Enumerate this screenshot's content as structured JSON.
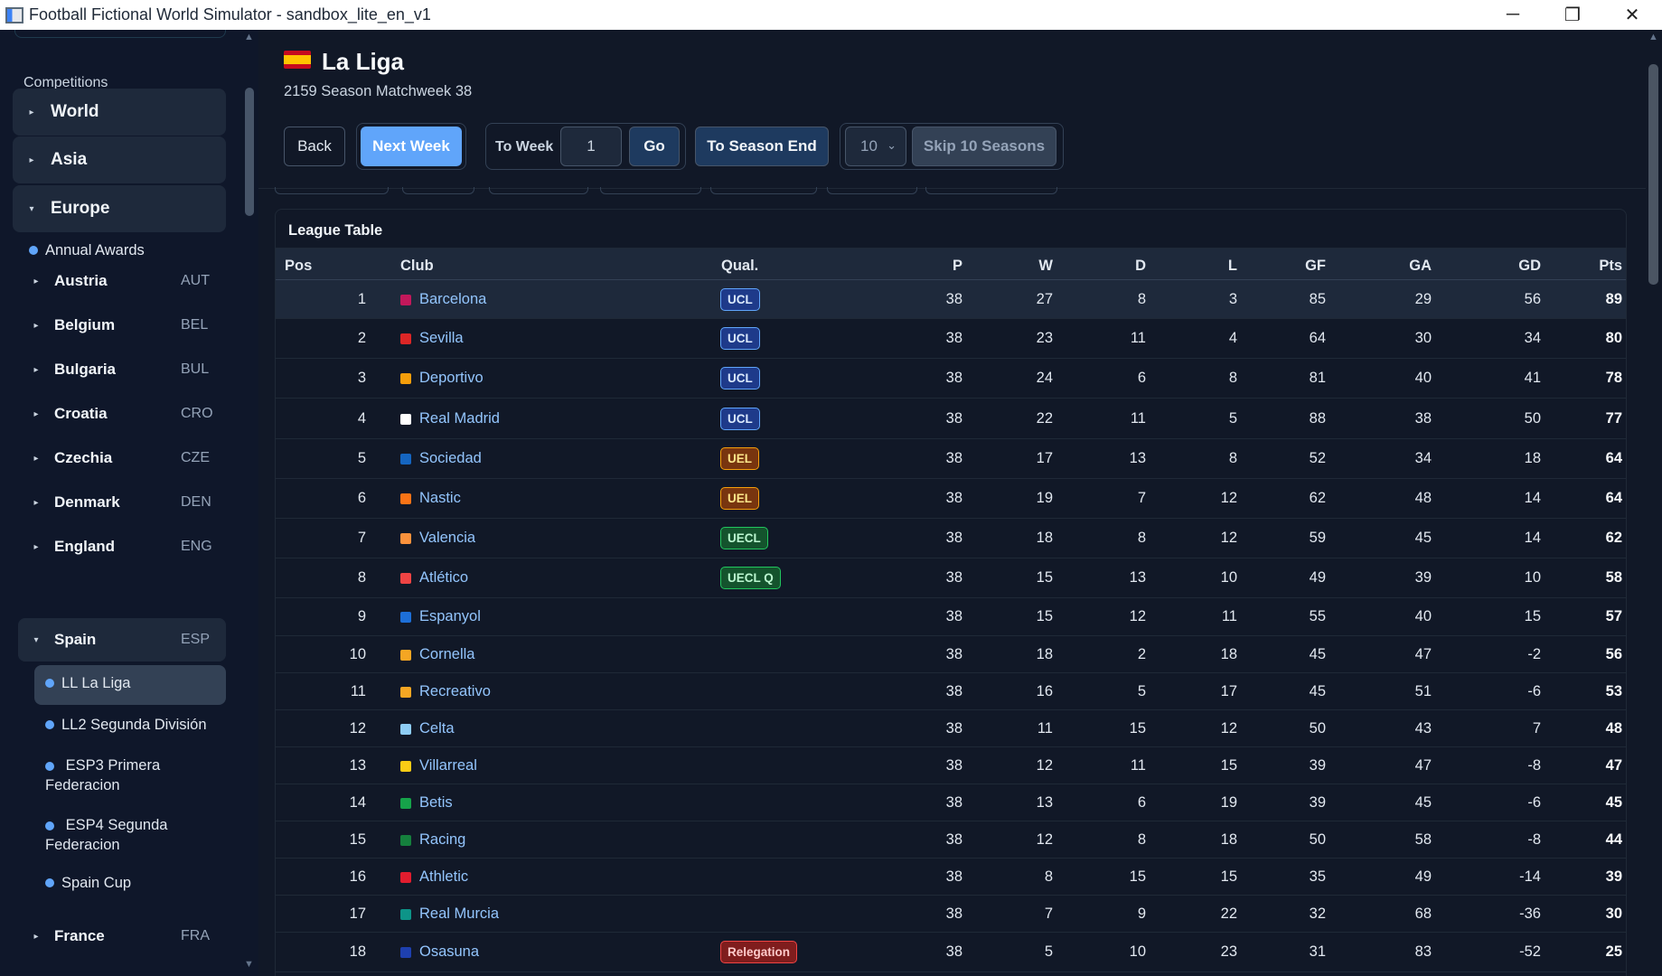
{
  "window": {
    "title": "Football Fictional World Simulator - sandbox_lite_en_v1",
    "minimize": "─",
    "restore": "❐",
    "close": "✕"
  },
  "sidebar": {
    "heading": "Competitions",
    "groups": [
      {
        "label": "World",
        "arrow": "▸"
      },
      {
        "label": "Asia",
        "arrow": "▸"
      },
      {
        "label": "Europe",
        "arrow": "▾"
      }
    ],
    "annual_awards": "Annual Awards",
    "countries": [
      {
        "name": "Austria",
        "code": "AUT",
        "arrow": "▸"
      },
      {
        "name": "Belgium",
        "code": "BEL",
        "arrow": "▸"
      },
      {
        "name": "Bulgaria",
        "code": "BUL",
        "arrow": "▸"
      },
      {
        "name": "Croatia",
        "code": "CRO",
        "arrow": "▸"
      },
      {
        "name": "Czechia",
        "code": "CZE",
        "arrow": "▸"
      },
      {
        "name": "Denmark",
        "code": "DEN",
        "arrow": "▸"
      },
      {
        "name": "England",
        "code": "ENG",
        "arrow": "▸"
      },
      {
        "name": "Spain",
        "code": "ESP",
        "arrow": "▾"
      }
    ],
    "spain_leagues": [
      "LL La Liga",
      "LL2 Segunda División",
      "ESP3 Primera Federacion",
      "ESP4 Segunda Federacion",
      "Spain Cup"
    ],
    "after": {
      "name": "France",
      "code": "FRA",
      "arrow": "▸"
    }
  },
  "header": {
    "title": "La Liga",
    "subtitle": "2159 Season Matchweek 38",
    "back": "Back",
    "next_week": "Next Week",
    "to_week_label": "To Week",
    "to_week_value": "1",
    "go": "Go",
    "to_season_end": "To Season End",
    "skip_select": "10",
    "skip_label": "Skip 10 Seasons"
  },
  "table": {
    "title": "League Table",
    "columns": {
      "pos": "Pos",
      "club": "Club",
      "qual": "Qual.",
      "p": "P",
      "w": "W",
      "d": "D",
      "l": "L",
      "gf": "GF",
      "ga": "GA",
      "gd": "GD",
      "pts": "Pts"
    },
    "rows": [
      {
        "pos": "1",
        "club": "Barcelona",
        "color": "#c2185b",
        "qual": "UCL",
        "p": "38",
        "w": "27",
        "d": "8",
        "l": "3",
        "gf": "85",
        "ga": "29",
        "gd": "56",
        "pts": "89"
      },
      {
        "pos": "2",
        "club": "Sevilla",
        "color": "#dc2626",
        "qual": "UCL",
        "p": "38",
        "w": "23",
        "d": "11",
        "l": "4",
        "gf": "64",
        "ga": "30",
        "gd": "34",
        "pts": "80"
      },
      {
        "pos": "3",
        "club": "Deportivo",
        "color": "#f59e0b",
        "qual": "UCL",
        "p": "38",
        "w": "24",
        "d": "6",
        "l": "8",
        "gf": "81",
        "ga": "40",
        "gd": "41",
        "pts": "78"
      },
      {
        "pos": "4",
        "club": "Real Madrid",
        "color": "#ffffff",
        "qual": "UCL",
        "p": "38",
        "w": "22",
        "d": "11",
        "l": "5",
        "gf": "88",
        "ga": "38",
        "gd": "50",
        "pts": "77"
      },
      {
        "pos": "5",
        "club": "Sociedad",
        "color": "#1565c0",
        "qual": "UEL",
        "p": "38",
        "w": "17",
        "d": "13",
        "l": "8",
        "gf": "52",
        "ga": "34",
        "gd": "18",
        "pts": "64"
      },
      {
        "pos": "6",
        "club": "Nastic",
        "color": "#f97316",
        "qual": "UEL",
        "p": "38",
        "w": "19",
        "d": "7",
        "l": "12",
        "gf": "62",
        "ga": "48",
        "gd": "14",
        "pts": "64"
      },
      {
        "pos": "7",
        "club": "Valencia",
        "color": "#fb923c",
        "qual": "UECL",
        "p": "38",
        "w": "18",
        "d": "8",
        "l": "12",
        "gf": "59",
        "ga": "45",
        "gd": "14",
        "pts": "62"
      },
      {
        "pos": "8",
        "club": "Atlético",
        "color": "#ef4444",
        "qual": "UECL Q",
        "p": "38",
        "w": "15",
        "d": "13",
        "l": "10",
        "gf": "49",
        "ga": "39",
        "gd": "10",
        "pts": "58"
      },
      {
        "pos": "9",
        "club": "Espanyol",
        "color": "#1d6fd8",
        "qual": "",
        "p": "38",
        "w": "15",
        "d": "12",
        "l": "11",
        "gf": "55",
        "ga": "40",
        "gd": "15",
        "pts": "57"
      },
      {
        "pos": "10",
        "club": "Cornella",
        "color": "#f5a623",
        "qual": "",
        "p": "38",
        "w": "18",
        "d": "2",
        "l": "18",
        "gf": "45",
        "ga": "47",
        "gd": "-2",
        "pts": "56"
      },
      {
        "pos": "11",
        "club": "Recreativo",
        "color": "#f5a623",
        "qual": "",
        "p": "38",
        "w": "16",
        "d": "5",
        "l": "17",
        "gf": "45",
        "ga": "51",
        "gd": "-6",
        "pts": "53"
      },
      {
        "pos": "12",
        "club": "Celta",
        "color": "#8ecdf5",
        "qual": "",
        "p": "38",
        "w": "11",
        "d": "15",
        "l": "12",
        "gf": "50",
        "ga": "43",
        "gd": "7",
        "pts": "48"
      },
      {
        "pos": "13",
        "club": "Villarreal",
        "color": "#facc15",
        "qual": "",
        "p": "38",
        "w": "12",
        "d": "11",
        "l": "15",
        "gf": "39",
        "ga": "47",
        "gd": "-8",
        "pts": "47"
      },
      {
        "pos": "14",
        "club": "Betis",
        "color": "#16a34a",
        "qual": "",
        "p": "38",
        "w": "13",
        "d": "6",
        "l": "19",
        "gf": "39",
        "ga": "45",
        "gd": "-6",
        "pts": "45"
      },
      {
        "pos": "15",
        "club": "Racing",
        "color": "#15803d",
        "qual": "",
        "p": "38",
        "w": "12",
        "d": "8",
        "l": "18",
        "gf": "50",
        "ga": "58",
        "gd": "-8",
        "pts": "44"
      },
      {
        "pos": "16",
        "club": "Athletic",
        "color": "#e11d2e",
        "qual": "",
        "p": "38",
        "w": "8",
        "d": "15",
        "l": "15",
        "gf": "35",
        "ga": "49",
        "gd": "-14",
        "pts": "39"
      },
      {
        "pos": "17",
        "club": "Real Murcia",
        "color": "#0d9488",
        "qual": "",
        "p": "38",
        "w": "7",
        "d": "9",
        "l": "22",
        "gf": "32",
        "ga": "68",
        "gd": "-36",
        "pts": "30"
      },
      {
        "pos": "18",
        "club": "Osasuna",
        "color": "#1e40af",
        "qual": "Relegation",
        "p": "38",
        "w": "5",
        "d": "10",
        "l": "23",
        "gf": "31",
        "ga": "83",
        "gd": "-52",
        "pts": "25"
      }
    ]
  }
}
